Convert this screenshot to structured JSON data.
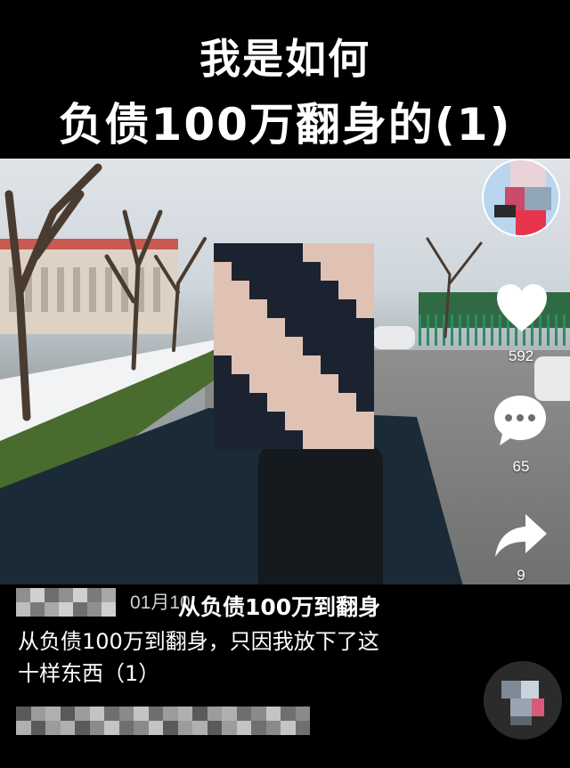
{
  "title": {
    "line1": "我是如何",
    "line2": "负债100万翻身的(1)"
  },
  "sidebar": {
    "avatar_icon": "user-avatar",
    "like_icon": "heart-icon",
    "like_count": "592",
    "comment_icon": "comment-bubble-icon",
    "comment_count": "65",
    "share_icon": "share-arrow-icon",
    "share_count": "9"
  },
  "post": {
    "date": "01月10",
    "topic": "从负债100万到翻身",
    "caption_line1": "从负债100万到翻身，只因我放下了这",
    "caption_line2": "十样东西（1）",
    "music_icon": "music-disc-icon"
  },
  "colors": {
    "background": "#000000",
    "text": "#ffffff",
    "like_icon": "#ffffff"
  }
}
